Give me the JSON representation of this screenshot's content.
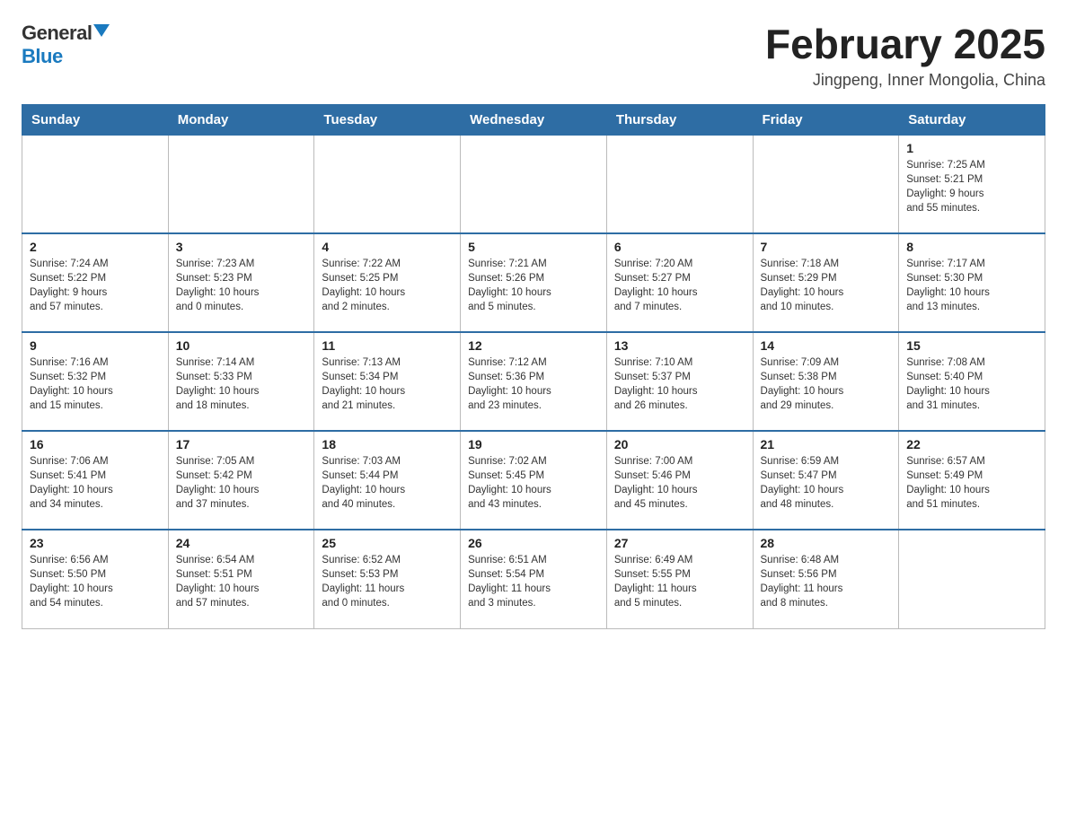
{
  "logo": {
    "general": "General",
    "blue": "Blue"
  },
  "title": "February 2025",
  "location": "Jingpeng, Inner Mongolia, China",
  "weekdays": [
    "Sunday",
    "Monday",
    "Tuesday",
    "Wednesday",
    "Thursday",
    "Friday",
    "Saturday"
  ],
  "weeks": [
    [
      {
        "day": "",
        "info": ""
      },
      {
        "day": "",
        "info": ""
      },
      {
        "day": "",
        "info": ""
      },
      {
        "day": "",
        "info": ""
      },
      {
        "day": "",
        "info": ""
      },
      {
        "day": "",
        "info": ""
      },
      {
        "day": "1",
        "info": "Sunrise: 7:25 AM\nSunset: 5:21 PM\nDaylight: 9 hours\nand 55 minutes."
      }
    ],
    [
      {
        "day": "2",
        "info": "Sunrise: 7:24 AM\nSunset: 5:22 PM\nDaylight: 9 hours\nand 57 minutes."
      },
      {
        "day": "3",
        "info": "Sunrise: 7:23 AM\nSunset: 5:23 PM\nDaylight: 10 hours\nand 0 minutes."
      },
      {
        "day": "4",
        "info": "Sunrise: 7:22 AM\nSunset: 5:25 PM\nDaylight: 10 hours\nand 2 minutes."
      },
      {
        "day": "5",
        "info": "Sunrise: 7:21 AM\nSunset: 5:26 PM\nDaylight: 10 hours\nand 5 minutes."
      },
      {
        "day": "6",
        "info": "Sunrise: 7:20 AM\nSunset: 5:27 PM\nDaylight: 10 hours\nand 7 minutes."
      },
      {
        "day": "7",
        "info": "Sunrise: 7:18 AM\nSunset: 5:29 PM\nDaylight: 10 hours\nand 10 minutes."
      },
      {
        "day": "8",
        "info": "Sunrise: 7:17 AM\nSunset: 5:30 PM\nDaylight: 10 hours\nand 13 minutes."
      }
    ],
    [
      {
        "day": "9",
        "info": "Sunrise: 7:16 AM\nSunset: 5:32 PM\nDaylight: 10 hours\nand 15 minutes."
      },
      {
        "day": "10",
        "info": "Sunrise: 7:14 AM\nSunset: 5:33 PM\nDaylight: 10 hours\nand 18 minutes."
      },
      {
        "day": "11",
        "info": "Sunrise: 7:13 AM\nSunset: 5:34 PM\nDaylight: 10 hours\nand 21 minutes."
      },
      {
        "day": "12",
        "info": "Sunrise: 7:12 AM\nSunset: 5:36 PM\nDaylight: 10 hours\nand 23 minutes."
      },
      {
        "day": "13",
        "info": "Sunrise: 7:10 AM\nSunset: 5:37 PM\nDaylight: 10 hours\nand 26 minutes."
      },
      {
        "day": "14",
        "info": "Sunrise: 7:09 AM\nSunset: 5:38 PM\nDaylight: 10 hours\nand 29 minutes."
      },
      {
        "day": "15",
        "info": "Sunrise: 7:08 AM\nSunset: 5:40 PM\nDaylight: 10 hours\nand 31 minutes."
      }
    ],
    [
      {
        "day": "16",
        "info": "Sunrise: 7:06 AM\nSunset: 5:41 PM\nDaylight: 10 hours\nand 34 minutes."
      },
      {
        "day": "17",
        "info": "Sunrise: 7:05 AM\nSunset: 5:42 PM\nDaylight: 10 hours\nand 37 minutes."
      },
      {
        "day": "18",
        "info": "Sunrise: 7:03 AM\nSunset: 5:44 PM\nDaylight: 10 hours\nand 40 minutes."
      },
      {
        "day": "19",
        "info": "Sunrise: 7:02 AM\nSunset: 5:45 PM\nDaylight: 10 hours\nand 43 minutes."
      },
      {
        "day": "20",
        "info": "Sunrise: 7:00 AM\nSunset: 5:46 PM\nDaylight: 10 hours\nand 45 minutes."
      },
      {
        "day": "21",
        "info": "Sunrise: 6:59 AM\nSunset: 5:47 PM\nDaylight: 10 hours\nand 48 minutes."
      },
      {
        "day": "22",
        "info": "Sunrise: 6:57 AM\nSunset: 5:49 PM\nDaylight: 10 hours\nand 51 minutes."
      }
    ],
    [
      {
        "day": "23",
        "info": "Sunrise: 6:56 AM\nSunset: 5:50 PM\nDaylight: 10 hours\nand 54 minutes."
      },
      {
        "day": "24",
        "info": "Sunrise: 6:54 AM\nSunset: 5:51 PM\nDaylight: 10 hours\nand 57 minutes."
      },
      {
        "day": "25",
        "info": "Sunrise: 6:52 AM\nSunset: 5:53 PM\nDaylight: 11 hours\nand 0 minutes."
      },
      {
        "day": "26",
        "info": "Sunrise: 6:51 AM\nSunset: 5:54 PM\nDaylight: 11 hours\nand 3 minutes."
      },
      {
        "day": "27",
        "info": "Sunrise: 6:49 AM\nSunset: 5:55 PM\nDaylight: 11 hours\nand 5 minutes."
      },
      {
        "day": "28",
        "info": "Sunrise: 6:48 AM\nSunset: 5:56 PM\nDaylight: 11 hours\nand 8 minutes."
      },
      {
        "day": "",
        "info": ""
      }
    ]
  ]
}
